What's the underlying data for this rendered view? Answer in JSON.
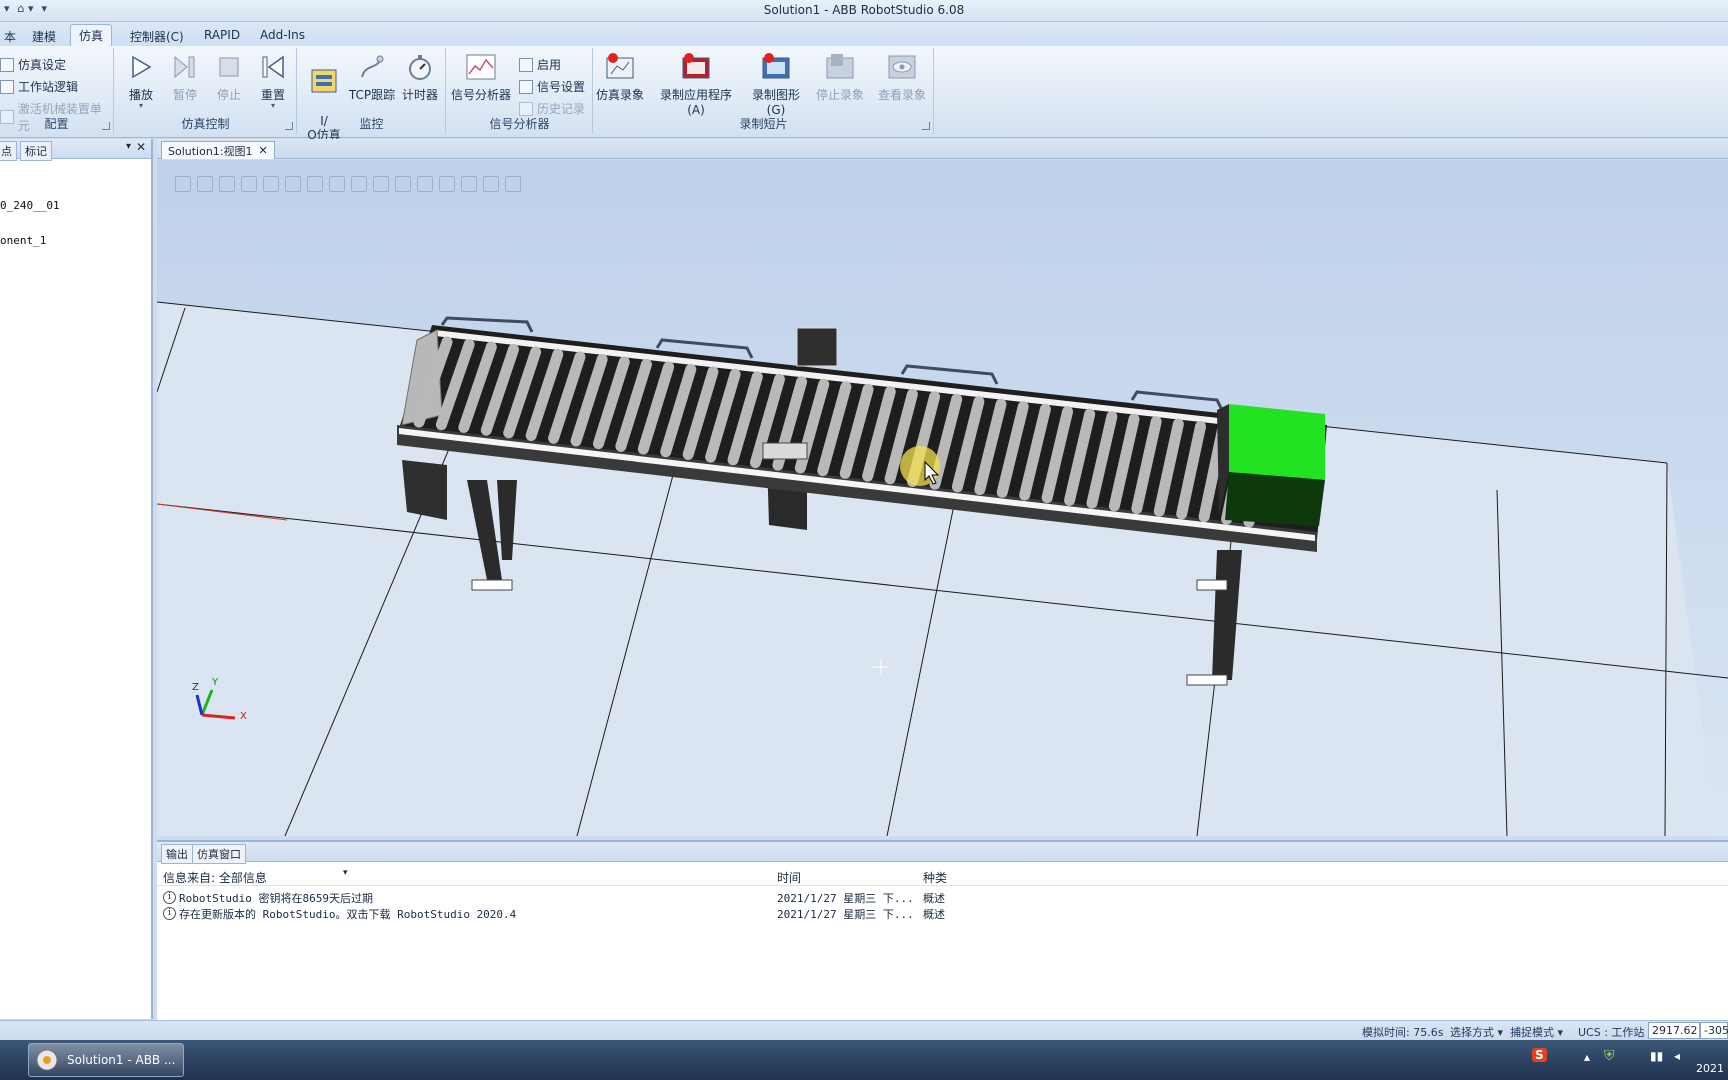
{
  "window": {
    "title": "Solution1 - ABB RobotStudio 6.08"
  },
  "ribbon_tabs": [
    "本",
    "建模",
    "仿真",
    "控制器(C)",
    "RAPID",
    "Add-Ins"
  ],
  "groups": {
    "config": {
      "label": "配置",
      "items": [
        "仿真设定",
        "工作站逻辑",
        "激活机械装置单元"
      ]
    },
    "sim_control": {
      "label": "仿真控制",
      "buttons": [
        "播放",
        "暂停",
        "停止",
        "重置"
      ]
    },
    "monitor": {
      "label": "监控",
      "buttons": [
        "I/\nO仿真器",
        "TCP跟踪",
        "计时器"
      ]
    },
    "signal_analyzer": {
      "label": "信号分析器",
      "big": "信号分析器",
      "small": [
        "启用",
        "信号设置",
        "历史记录"
      ]
    },
    "recording": {
      "label": "录制短片",
      "buttons": [
        "仿真录象",
        "录制应用程序(A)",
        "录制图形(G)",
        "停止录象",
        "查看录象"
      ]
    }
  },
  "left_panel": {
    "tabs": [
      "点",
      "标记"
    ],
    "items": [
      "0_240__01",
      "onent_1"
    ]
  },
  "document_tab": {
    "label": "Solution1:视图1"
  },
  "viewport": {
    "axis_labels": {
      "x": "X",
      "y": "Y",
      "z": "Z"
    },
    "colors": {
      "conveyor_frame": "#2b2b2b",
      "roller": "#b9b9b9",
      "box": "#22e322",
      "highlight": "#f4e04d"
    }
  },
  "output": {
    "tabs": [
      "输出",
      "仿真窗口"
    ],
    "filter_label": "信息来自: 全部信息",
    "columns": [
      "时间",
      "种类"
    ],
    "rows": [
      {
        "message": "RobotStudio 密钥将在8659天后过期",
        "time": "2021/1/27 星期三 下...",
        "kind": "概述"
      },
      {
        "message": "存在更新版本的 RobotStudio。双击下载 RobotStudio 2020.4",
        "time": "2021/1/27 星期三 下...",
        "kind": "概述"
      }
    ]
  },
  "statusbar": {
    "sim_time": "模拟时间: 75.6s",
    "select_mode": "选择方式 ▾",
    "snap_mode": "捕捉模式 ▾",
    "ucs": "UCS : 工作站",
    "coord_x": "2917.62",
    "coord_y": "-305"
  },
  "taskbar": {
    "app_label": "Solution1 - ABB ...",
    "year": "2021"
  }
}
